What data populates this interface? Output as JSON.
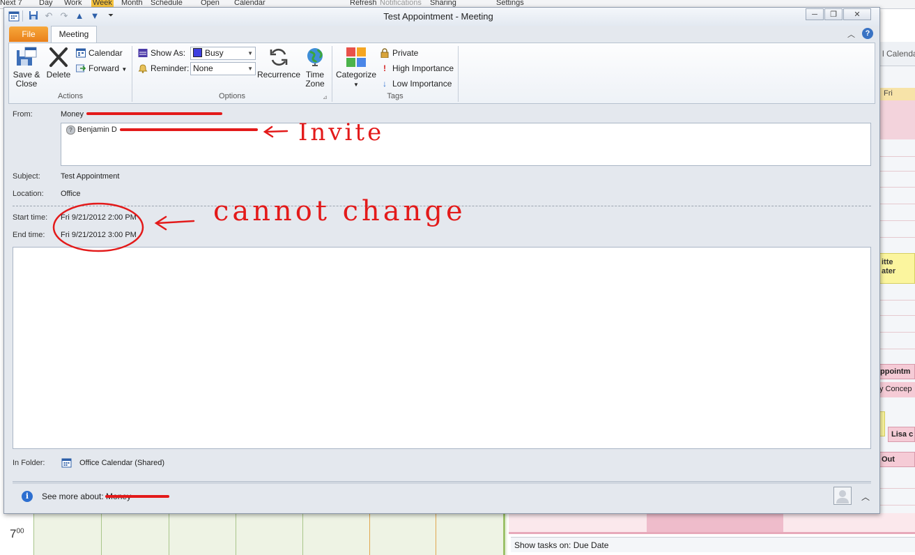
{
  "background": {
    "ribbon_labels": [
      "Next 7",
      "Day",
      "Work",
      "Week",
      "Month",
      "Schedule",
      "Open",
      "Calendar",
      "Refresh",
      "Notifications",
      "Sharing",
      "Settings"
    ],
    "side_labels": [
      "l Calendar",
      "Fri",
      "itte",
      "ater",
      "ppointm",
      "y Concep",
      "Lisa c",
      "Out"
    ],
    "time_label": "7",
    "time_minutes": "00",
    "tasks_bar": "Show tasks on: Due Date"
  },
  "window": {
    "title": "Test Appointment  -  Meeting",
    "minimize": "─",
    "restore": "❐",
    "close": "✕"
  },
  "tabs": {
    "file": "File",
    "meeting": "Meeting"
  },
  "ribbon": {
    "actions": {
      "group": "Actions",
      "save_close_1": "Save &",
      "save_close_2": "Close",
      "delete": "Delete",
      "calendar": "Calendar",
      "forward": "Forward"
    },
    "options": {
      "group": "Options",
      "show_as_label": "Show As:",
      "show_as_value": "Busy",
      "reminder_label": "Reminder:",
      "reminder_value": "None",
      "recurrence": "Recurrence",
      "time_zone_1": "Time",
      "time_zone_2": "Zone"
    },
    "tags": {
      "group": "Tags",
      "categorize": "Categorize",
      "private": "Private",
      "high_importance": "High Importance",
      "low_importance": "Low Importance"
    }
  },
  "form": {
    "from_label": "From:",
    "from_value": "Money",
    "to_value": "Benjamin D",
    "subject_label": "Subject:",
    "subject_value": "Test Appointment",
    "location_label": "Location:",
    "location_value": "Office",
    "start_label": "Start time:",
    "start_value": "Fri 9/21/2012 2:00 PM",
    "end_label": "End time:",
    "end_value": "Fri 9/21/2012 3:00 PM",
    "folder_label": "In Folder:",
    "folder_value": "Office Calendar (Shared)",
    "see_more": "See more about: Money"
  },
  "annotations": {
    "invite": "Invite",
    "cannot_change": "cannot change"
  }
}
